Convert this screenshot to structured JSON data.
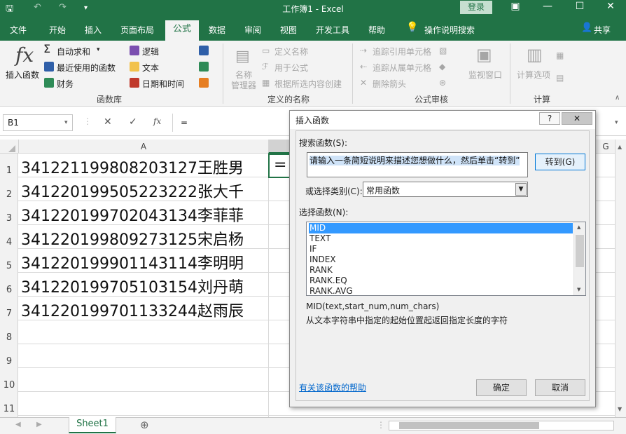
{
  "title": "工作簿1  -  Excel",
  "login_label": "登录",
  "tabs": [
    "文件",
    "开始",
    "插入",
    "页面布局",
    "公式",
    "数据",
    "审阅",
    "视图",
    "开发工具",
    "帮助"
  ],
  "tell_me": "操作说明搜索",
  "share": "共享",
  "ribbon": {
    "insert_function": "插入函数",
    "autosum": "自动求和",
    "recent": "最近使用的函数",
    "financial": "财务",
    "logical": "逻辑",
    "text": "文本",
    "datetime": "日期和时间",
    "group_library": "函数库",
    "name_manager_1": "名称",
    "name_manager_2": "管理器",
    "define_name": "定义名称",
    "use_in_formula": "用于公式",
    "create_from_selection": "根据所选内容创建",
    "group_names": "定义的名称",
    "trace_precedents": "追踪引用单元格",
    "trace_dependents": "追踪从属单元格",
    "remove_arrows": "删除箭头",
    "watch_window": "监视窗口",
    "group_audit": "公式审核",
    "calc_options": "计算选项",
    "group_calc": "计算"
  },
  "formula_bar": {
    "name_box": "B1",
    "fx": "fx",
    "content": "="
  },
  "columns": {
    "a": "A",
    "g": "G"
  },
  "rows": [
    "1",
    "2",
    "3",
    "4",
    "5",
    "6",
    "7",
    "8",
    "9",
    "10",
    "11"
  ],
  "cells": [
    "341221199808203127王胜男",
    "341220199505223222张大千",
    "341220199702043134李菲菲",
    "341220199809273125宋启杨",
    "341220199901143114李明明",
    "341220199705103154刘丹萌",
    "341220199701133244赵雨辰"
  ],
  "b1_value": "=",
  "sheet_tab": "Sheet1",
  "dialog": {
    "title": "插入函数",
    "help_btn": "?",
    "close_btn": "✕",
    "search_label": "搜索函数(S):",
    "search_value": "请输入一条简短说明来描述您想做什么，然后单击“转到”",
    "go_button": "转到(G)",
    "category_label": "或选择类别(C):",
    "category_value": "常用函数",
    "select_label": "选择函数(N):",
    "functions": [
      "MID",
      "TEXT",
      "IF",
      "INDEX",
      "RANK",
      "RANK.EQ",
      "RANK.AVG"
    ],
    "selected_function": "MID",
    "signature": "MID(text,start_num,num_chars)",
    "description": "从文本字符串中指定的起始位置起返回指定长度的字符",
    "help_link": "有关该函数的帮助",
    "ok": "确定",
    "cancel": "取消"
  },
  "colors": {
    "excel_green": "#217346",
    "selection": "#3399ff"
  }
}
